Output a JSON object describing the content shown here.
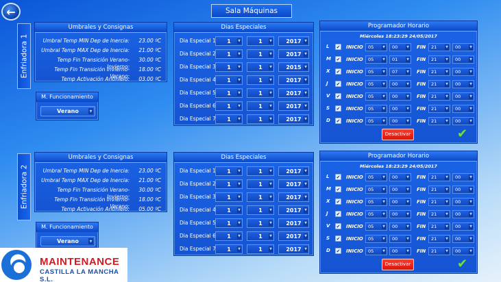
{
  "header": {
    "title": "Sala Máquinas"
  },
  "logo": {
    "line1": "MAINTENANCE",
    "line2": "CASTILLA LA MANCHA S.L."
  },
  "sections": [
    {
      "label": "Enfriadora 1",
      "thresholds": {
        "title": "Umbrales y Consignas",
        "rows": [
          {
            "label": "Umbral Temp MIN Dep de Inercia:",
            "value": "23.00 ºC"
          },
          {
            "label": "Umbral Temp MAX Dep de Inercia:",
            "value": "21.00 ºC"
          },
          {
            "label": "Temp Fin Transición Verano-Invierno:",
            "value": "30.00 ºC"
          },
          {
            "label": "Temp Fin Transición Invierno-Verano:",
            "value": "18.00 ºC"
          },
          {
            "label": "Temp Activación Antihielo:",
            "value": "03.00 ºC"
          }
        ]
      },
      "mode": {
        "title": "M. Funcionamiento",
        "value": "Verano"
      },
      "special_days": {
        "title": "Dias Especiales",
        "rows": [
          {
            "label": "Dia Especial 1",
            "day": "1",
            "month": "1",
            "year": "2017"
          },
          {
            "label": "Dia Especial 2",
            "day": "1",
            "month": "1",
            "year": "2017"
          },
          {
            "label": "Dia Especial 3",
            "day": "1",
            "month": "1",
            "year": "2015"
          },
          {
            "label": "Dia Especial 4",
            "day": "1",
            "month": "1",
            "year": "2017"
          },
          {
            "label": "Dia Especial 5",
            "day": "1",
            "month": "1",
            "year": "2017"
          },
          {
            "label": "Dia Especial 6",
            "day": "1",
            "month": "1",
            "year": "2017"
          },
          {
            "label": "Dia Especial 7",
            "day": "1",
            "month": "1",
            "year": "2017"
          }
        ]
      },
      "scheduler": {
        "title": "Programador Horario",
        "datetime": "Miércoles  18:23:29  24/05/2017",
        "start_word": "INICIO",
        "end_word": "FIN",
        "deactivate_label": "Desactivar",
        "rows": [
          {
            "day": "L",
            "checked": "✔",
            "start_h": "05",
            "start_m": "00",
            "end_h": "21",
            "end_m": "00"
          },
          {
            "day": "M",
            "checked": "✔",
            "start_h": "05",
            "start_m": "01",
            "end_h": "21",
            "end_m": "00"
          },
          {
            "day": "X",
            "checked": "✔",
            "start_h": "05",
            "start_m": "07",
            "end_h": "21",
            "end_m": "00"
          },
          {
            "day": "J",
            "checked": "✔",
            "start_h": "05",
            "start_m": "00",
            "end_h": "21",
            "end_m": "00"
          },
          {
            "day": "V",
            "checked": "✔",
            "start_h": "05",
            "start_m": "00",
            "end_h": "21",
            "end_m": "00"
          },
          {
            "day": "S",
            "checked": "✔",
            "start_h": "05",
            "start_m": "00",
            "end_h": "21",
            "end_m": "00"
          },
          {
            "day": "D",
            "checked": "✔",
            "start_h": "05",
            "start_m": "00",
            "end_h": "21",
            "end_m": "00"
          }
        ]
      }
    },
    {
      "label": "Enfriadora 2",
      "thresholds": {
        "title": "Umbrales y Consignas",
        "rows": [
          {
            "label": "Umbral Temp MIN Dep de Inercia:",
            "value": "23.00 ºC"
          },
          {
            "label": "Umbral Temp MAX Dep de Inercia:",
            "value": "21.00 ºC"
          },
          {
            "label": "Temp Fin Transición Verano-Invierno:",
            "value": "30.00 ºC"
          },
          {
            "label": "Temp Fin Transición Invierno-Verano:",
            "value": "18.00 ºC"
          },
          {
            "label": "Temp Activación Antihielo:",
            "value": "05.00 ºC"
          }
        ]
      },
      "mode": {
        "title": "M. Funcionamiento",
        "value": "Verano"
      },
      "special_days": {
        "title": "Dias Especiales",
        "rows": [
          {
            "label": "Dia Especial 1",
            "day": "1",
            "month": "1",
            "year": "2017"
          },
          {
            "label": "Dia Especial 2",
            "day": "1",
            "month": "1",
            "year": "2017"
          },
          {
            "label": "Dia Especial 3",
            "day": "1",
            "month": "1",
            "year": "2017"
          },
          {
            "label": "Dia Especial 4",
            "day": "1",
            "month": "1",
            "year": "2017"
          },
          {
            "label": "Dia Especial 5",
            "day": "1",
            "month": "1",
            "year": "2017"
          },
          {
            "label": "Dia Especial 6",
            "day": "1",
            "month": "1",
            "year": "2017"
          },
          {
            "label": "Dia Especial 7",
            "day": "1",
            "month": "1",
            "year": "2017"
          }
        ]
      },
      "scheduler": {
        "title": "Programador Horario",
        "datetime": "Miércoles  18:23:29  24/05/2017",
        "start_word": "INICIO",
        "end_word": "FIN",
        "deactivate_label": "Desactivar",
        "rows": [
          {
            "day": "L",
            "checked": "✔",
            "start_h": "05",
            "start_m": "00",
            "end_h": "21",
            "end_m": "00"
          },
          {
            "day": "M",
            "checked": "✔",
            "start_h": "05",
            "start_m": "00",
            "end_h": "21",
            "end_m": "00"
          },
          {
            "day": "X",
            "checked": "✔",
            "start_h": "05",
            "start_m": "00",
            "end_h": "21",
            "end_m": "00"
          },
          {
            "day": "J",
            "checked": "✔",
            "start_h": "05",
            "start_m": "00",
            "end_h": "21",
            "end_m": "00"
          },
          {
            "day": "V",
            "checked": "✔",
            "start_h": "05",
            "start_m": "00",
            "end_h": "21",
            "end_m": "00"
          },
          {
            "day": "S",
            "checked": "✔",
            "start_h": "05",
            "start_m": "00",
            "end_h": "21",
            "end_m": "00"
          },
          {
            "day": "D",
            "checked": "✔",
            "start_h": "05",
            "start_m": "00",
            "end_h": "21",
            "end_m": "00"
          }
        ]
      }
    }
  ]
}
